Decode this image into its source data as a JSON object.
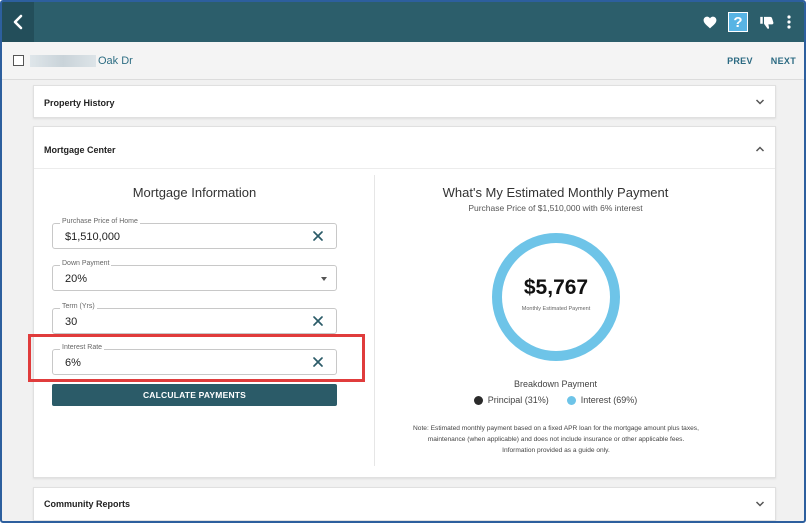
{
  "header": {
    "icons": [
      "back-arrow-icon",
      "heart-icon",
      "help-icon",
      "thumbs-down-icon",
      "kebab-menu-icon"
    ],
    "help_label": "?"
  },
  "subbar": {
    "address": "Oak Dr",
    "prev_label": "PREV",
    "next_label": "NEXT"
  },
  "sections": {
    "property_history": "Property History",
    "mortgage_center": "Mortgage Center",
    "community_reports": "Community Reports"
  },
  "mortgage_form": {
    "title": "Mortgage Information",
    "fields": [
      {
        "label": "Purchase Price of Home",
        "value": "$1,510,000"
      },
      {
        "label": "Down Payment",
        "value": "20%"
      },
      {
        "label": "Term (Yrs)",
        "value": "30"
      },
      {
        "label": "Interest Rate",
        "value": "6%"
      }
    ],
    "button_label": "CALCULATE PAYMENTS"
  },
  "estimate": {
    "title": "What's My Estimated Monthly Payment",
    "subtitle": "Purchase Price of $1,510,000 with 6% interest",
    "amount": "$5,767",
    "amount_caption": "Monthly Estimated Payment",
    "breakdown_title": "Breakdown Payment",
    "legend": [
      {
        "label": "Principal (31%)",
        "color": "#2b2b2b",
        "percent": 31
      },
      {
        "label": "Interest (69%)",
        "color": "#6ec4e8",
        "percent": 69
      }
    ],
    "note": "Note: Estimated monthly payment based on a fixed APR loan for the mortgage amount plus taxes, maintenance (when applicable) and does not include insurance or other applicable fees. Information provided as a guide only."
  },
  "colors": {
    "topbar": "#2c5e6b",
    "accent": "#2b5b68",
    "highlight": "#e03c3c",
    "principal": "#2b2b2b",
    "interest": "#6ec4e8"
  }
}
